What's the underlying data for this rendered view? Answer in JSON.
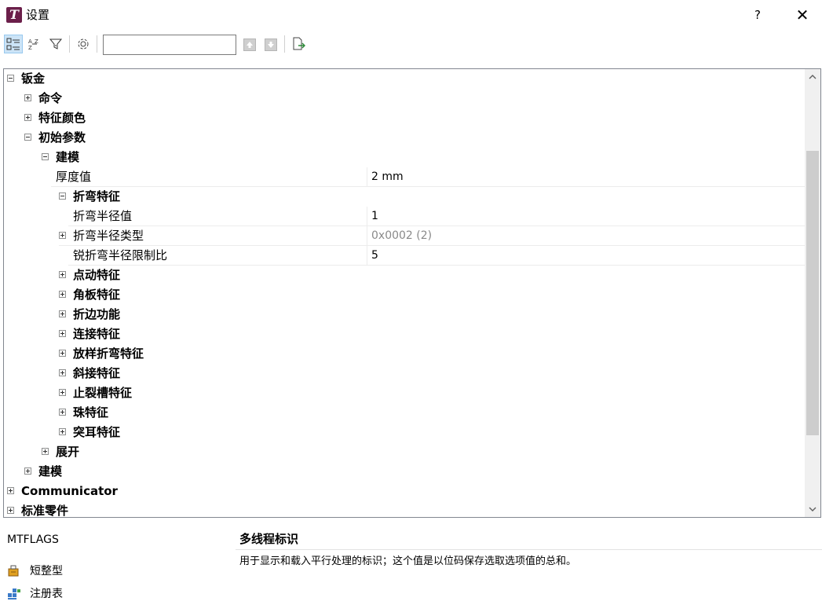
{
  "window": {
    "logo_letter": "T",
    "title": "设置",
    "help_label": "?",
    "close_label": "✕"
  },
  "toolbar": {
    "categorized_icon": "categorized-view-icon",
    "alphabetical_icon": "alphabetical-sort-icon",
    "filter_icon": "filter-icon",
    "settings_icon": "gear-icon",
    "search_value": "",
    "search_placeholder": "",
    "prev_icon": "arrow-up-icon",
    "next_icon": "arrow-down-icon",
    "export_icon": "export-icon"
  },
  "tree": {
    "sheet_metal": "钣金",
    "command": "命令",
    "feature_color": "特征颜色",
    "initial_params": "初始参数",
    "modeling": "建模",
    "thickness_name": "厚度值",
    "thickness_value": "2 mm",
    "bend_feature": "折弯特征",
    "bend_radius_name": "折弯半径值",
    "bend_radius_value": "1",
    "bend_radius_type_name": "折弯半径类型",
    "bend_radius_type_value": "0x0002 (2)",
    "sharp_bend_ratio_name": "锐折弯半径限制比",
    "sharp_bend_ratio_value": "5",
    "children": [
      "点动特征",
      "角板特征",
      "折边功能",
      "连接特征",
      "放样折弯特征",
      "斜接特征",
      "止裂槽特征",
      "珠特征",
      "突耳特征"
    ],
    "unfold": "展开",
    "modeling2": "建模",
    "communicator": "Communicator",
    "standard_parts": "标准零件"
  },
  "description": {
    "key": "MTFLAGS",
    "title": "多线程标识",
    "text": "用于显示和载入平行处理的标识；这个值是以位码保存选取选项值的总和。",
    "type_label": "短整型",
    "source_label": "注册表"
  },
  "colors": {
    "app_logo": "#6b1f4a",
    "selected_tool": "#cce4f7",
    "grey_value": "#8a8a8a"
  }
}
